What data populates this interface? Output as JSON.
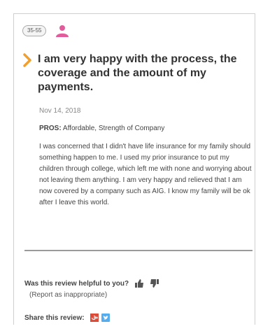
{
  "review": {
    "age_range": "35-55",
    "title": "I am very happy with the process, the coverage and the amount of my payments.",
    "date": "Nov 14, 2018",
    "pros_label": "PROS:",
    "pros_text": "Affordable, Strength of Company",
    "body": "I was concerned that I didn't have life insurance for my family should something happen to me. I used my prior insurance to put my children through college, which left me with none and worrying about not leaving them anything. I am very happy and relieved that I am now covered by a company such as AIG. I know my family will be ok after I leave this world."
  },
  "feedback": {
    "helpful_question": "Was this review helpful to you?",
    "report_link": "(Report as inappropriate)",
    "share_label": "Share this review:"
  },
  "icons": {
    "user": "user-icon",
    "chevron": "chevron-right-icon",
    "thumbs_up": "thumbs-up-icon",
    "thumbs_down": "thumbs-down-icon",
    "google_plus": "google-plus-icon",
    "twitter": "twitter-icon"
  },
  "colors": {
    "accent_orange": "#f0a030",
    "user_pink": "#e25b9a",
    "google_red": "#dd4b39",
    "twitter_blue": "#55acee"
  }
}
